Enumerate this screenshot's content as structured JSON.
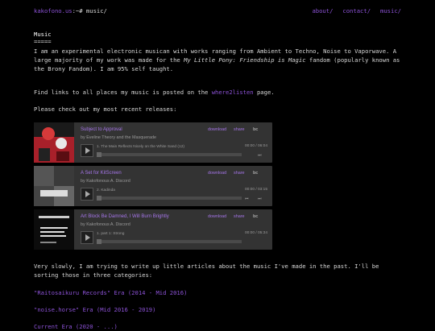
{
  "header": {
    "host": "kakofono.us",
    "path": ":~# music/",
    "nav": [
      "about/",
      "contact/",
      "music/"
    ]
  },
  "page": {
    "title": "Music",
    "underline": "=====",
    "intro_1": "I am an experimental electronic musican with works ranging from Ambient to Techno, Noise to Vaporwave. A large majority of my work was made for the ",
    "intro_em": "My Little Pony: Friendship is Magic",
    "intro_2": " fandom (popularly known as the Brony Fandom). I am 95% self taught.",
    "links_pre": "Find links to all places my music is posted on the ",
    "links_link": "where2listen",
    "links_post": " page.",
    "recent": "Please check out my most recent releases:",
    "articles": "Very slowly, I am trying to write up little articles about the music I've made in the past. I'll be sorting those in three categories:",
    "eras": [
      "\"Raitosaikuru Records\" Era (2014 - Mid 2016)",
      "\"noise.horse\" Era (Mid 2016 - 2019)",
      "Current Era (2020 - ...)"
    ]
  },
  "embeds": [
    {
      "title": "Subject to Approval",
      "artist": "by Eveline Theory and the Masquerade",
      "download": "download",
      "share": "share",
      "brand": "bc",
      "track": "1.  The Main Reflects Nicely on the White Sand (12)",
      "time": "00:00 / 06:04",
      "art_color": "#a8202a"
    },
    {
      "title": "A Set for KitScreen",
      "artist": "by Kakofonous A. Discord",
      "download": "download",
      "share": "share",
      "brand": "bc",
      "track": "2.  Kadinda",
      "time": "00:00 / 03:15",
      "art_color": "#3a3a3a"
    },
    {
      "title": "Art Block Be Damned, I Will Burn Brightly",
      "artist": "by Kakofonous A. Discord",
      "download": "download",
      "share": "share",
      "brand": "bc",
      "track": "1.  part 1: Strong",
      "time": "00:00 / 05:34",
      "art_color": "#111111"
    }
  ],
  "icons": {
    "play": "play-icon",
    "prev": "prev-icon",
    "next": "next-icon"
  }
}
